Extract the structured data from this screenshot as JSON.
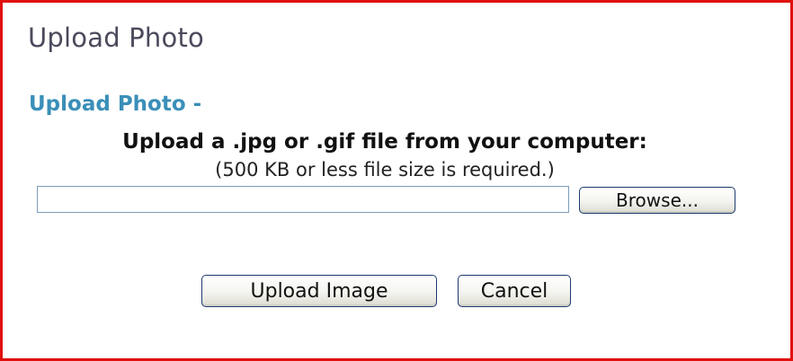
{
  "dialog": {
    "title": "Upload Photo",
    "subheading": "Upload Photo -",
    "instruction": "Upload a .jpg or .gif file from your computer:",
    "requirement": "(500 KB or less file size is required.)",
    "file_input": {
      "value": "",
      "placeholder": ""
    },
    "browse_label": "Browse...",
    "upload_label": "Upload Image",
    "cancel_label": "Cancel"
  },
  "colors": {
    "border": "#e0100e",
    "subheading": "#3a8fb8",
    "title": "#4a4a5c",
    "button_border": "#1d3a6e",
    "input_border": "#7f9db9"
  }
}
